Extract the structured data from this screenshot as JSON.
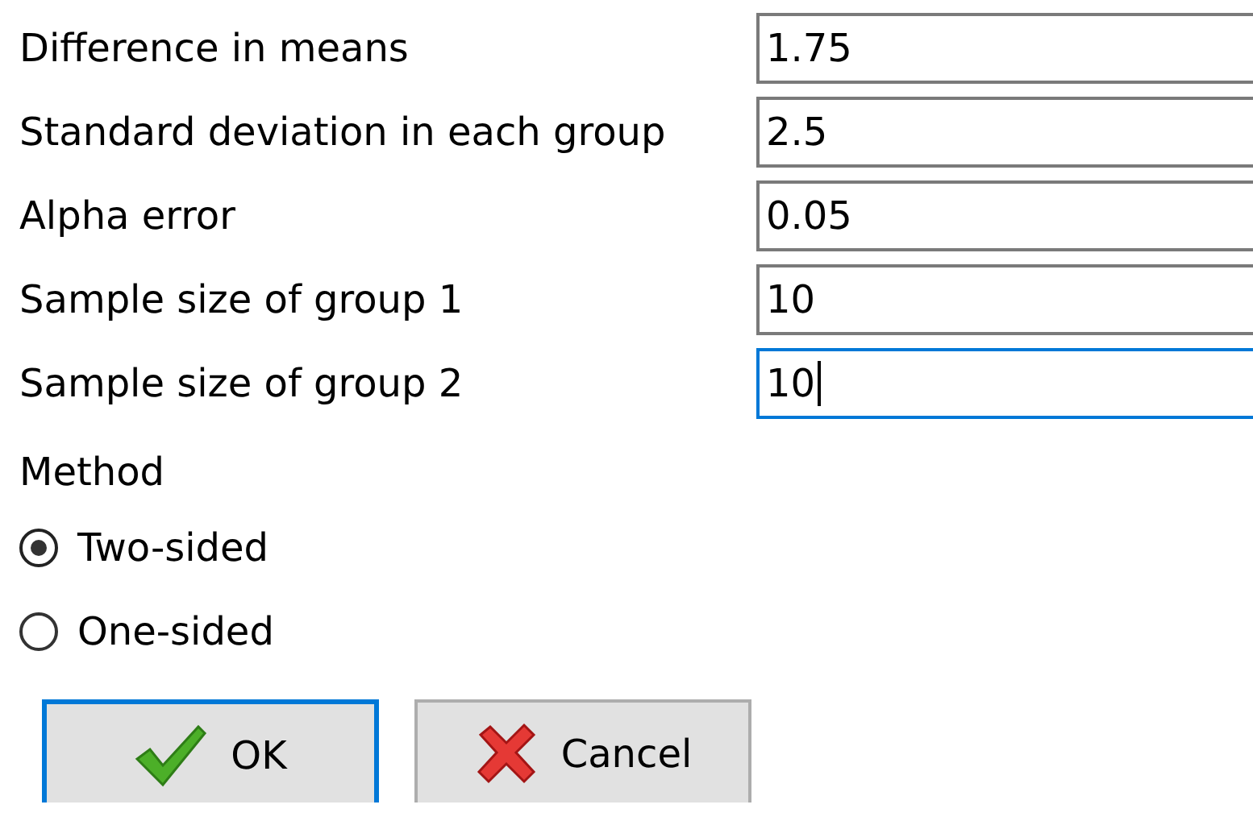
{
  "fields": [
    {
      "label": "Difference in means",
      "value": "1.75",
      "focused": false
    },
    {
      "label": "Standard deviation in each group",
      "value": "2.5",
      "focused": false
    },
    {
      "label": "Alpha error",
      "value": "0.05",
      "focused": false
    },
    {
      "label": "Sample size of group 1",
      "value": "10",
      "focused": false
    },
    {
      "label": "Sample size of group 2",
      "value": "10",
      "focused": true
    }
  ],
  "method": {
    "label": "Method",
    "options": [
      {
        "label": "Two-sided",
        "selected": true
      },
      {
        "label": "One-sided",
        "selected": false
      }
    ]
  },
  "buttons": [
    {
      "kind": "ok",
      "label": "OK",
      "focused": true
    },
    {
      "kind": "cancel",
      "label": "Cancel",
      "focused": false
    }
  ]
}
